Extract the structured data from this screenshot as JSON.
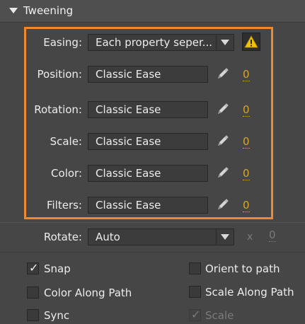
{
  "section": {
    "title": "Tweening"
  },
  "easing": {
    "label": "Easing:",
    "value": "Each property seper...",
    "warning_icon": "warning-triangle-icon"
  },
  "properties": [
    {
      "label": "Position:",
      "ease": "Classic Ease",
      "value": "0"
    },
    {
      "label": "Rotation:",
      "ease": "Classic Ease",
      "value": "0"
    },
    {
      "label": "Scale:",
      "ease": "Classic Ease",
      "value": "0"
    },
    {
      "label": "Color:",
      "ease": "Classic Ease",
      "value": "0"
    },
    {
      "label": "Filters:",
      "ease": "Classic Ease",
      "value": "0"
    }
  ],
  "rotate": {
    "label": "Rotate:",
    "value": "Auto",
    "times_symbol": "x",
    "count": "0"
  },
  "options": {
    "snap": {
      "label": "Snap",
      "checked": true
    },
    "orient_to_path": {
      "label": "Orient to path",
      "checked": false
    },
    "color_along_path": {
      "label": "Color Along Path",
      "checked": false
    },
    "scale_along_path": {
      "label": "Scale Along Path",
      "checked": false
    },
    "sync": {
      "label": "Sync",
      "checked": false
    },
    "scale": {
      "label": "Scale",
      "checked": true,
      "disabled": true
    }
  },
  "colors": {
    "panel_bg": "#464646",
    "highlight": "#ef8a2c",
    "value_accent": "#d8a52b",
    "warning": "#f2c200"
  }
}
